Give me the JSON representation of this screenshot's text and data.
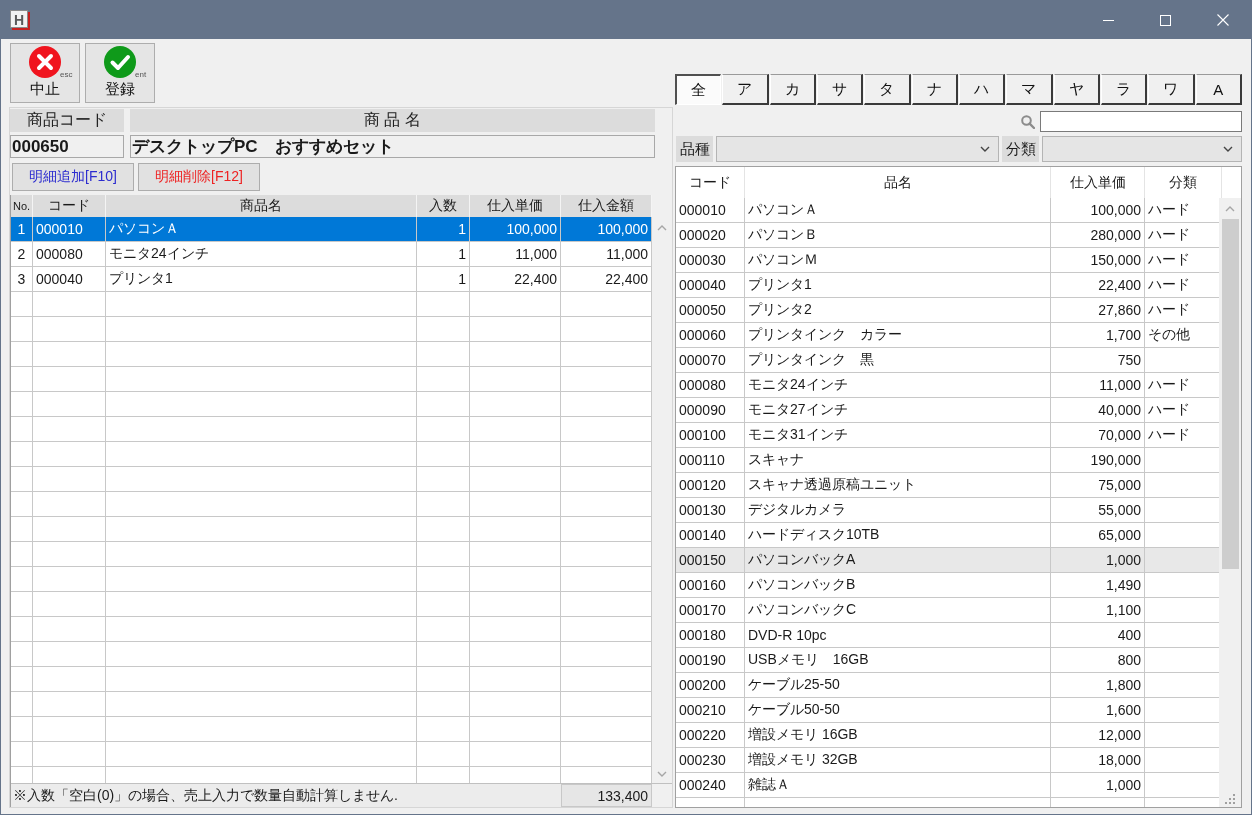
{
  "window": {
    "logo": "H"
  },
  "toolbar": [
    {
      "kind": "cancel",
      "label": "中止",
      "key": "esc"
    },
    {
      "kind": "save",
      "label": "登録",
      "key": "ent"
    }
  ],
  "product": {
    "code_label": "商品コード",
    "name_label": "商 品 名",
    "code": "000650",
    "name": "デスクトップPC　おすすめセット"
  },
  "detail_buttons": [
    {
      "kind": "add",
      "label": "明細追加[F10]"
    },
    {
      "kind": "delete",
      "label": "明細削除[F12]"
    }
  ],
  "detail_table": {
    "columns": [
      "No.",
      "コード",
      "商品名",
      "入数",
      "仕入単価",
      "仕入金額"
    ],
    "rows": [
      {
        "no": "1",
        "code": "000010",
        "name": "パソコンＡ",
        "qty": "1",
        "unit_price": "100,000",
        "amount": "100,000",
        "selected": true
      },
      {
        "no": "2",
        "code": "000080",
        "name": "モニタ24インチ",
        "qty": "1",
        "unit_price": "11,000",
        "amount": "11,000",
        "selected": false
      },
      {
        "no": "3",
        "code": "000040",
        "name": "プリンタ1",
        "qty": "1",
        "unit_price": "22,400",
        "amount": "22,400",
        "selected": false
      }
    ],
    "note": "※入数「空白(0)」の場合、売上入力で数量自動計算しません.",
    "total": "133,400"
  },
  "kana_tabs": [
    {
      "label": "全",
      "selected": true
    },
    {
      "label": "ア",
      "selected": false
    },
    {
      "label": "カ",
      "selected": false
    },
    {
      "label": "サ",
      "selected": false
    },
    {
      "label": "タ",
      "selected": false
    },
    {
      "label": "ナ",
      "selected": false
    },
    {
      "label": "ハ",
      "selected": false
    },
    {
      "label": "マ",
      "selected": false
    },
    {
      "label": "ヤ",
      "selected": false
    },
    {
      "label": "ラ",
      "selected": false
    },
    {
      "label": "ワ",
      "selected": false
    },
    {
      "label": "A",
      "selected": false
    }
  ],
  "filters": [
    {
      "label": "品種"
    },
    {
      "label": "分類"
    }
  ],
  "product_table": {
    "columns": [
      "コード",
      "品名",
      "仕入単価",
      "分類"
    ],
    "rows": [
      {
        "code": "000010",
        "name": "パソコンＡ",
        "unit_price": "100,000",
        "category": "ハード",
        "selected": false
      },
      {
        "code": "000020",
        "name": "パソコンＢ",
        "unit_price": "280,000",
        "category": "ハード",
        "selected": false
      },
      {
        "code": "000030",
        "name": "パソコンＭ",
        "unit_price": "150,000",
        "category": "ハード",
        "selected": false
      },
      {
        "code": "000040",
        "name": "プリンタ1",
        "unit_price": "22,400",
        "category": "ハード",
        "selected": false
      },
      {
        "code": "000050",
        "name": "プリンタ2",
        "unit_price": "27,860",
        "category": "ハード",
        "selected": false
      },
      {
        "code": "000060",
        "name": "プリンタインク　カラー",
        "unit_price": "1,700",
        "category": "その他",
        "selected": false
      },
      {
        "code": "000070",
        "name": "プリンタインク　黒",
        "unit_price": "750",
        "selected": false
      },
      {
        "code": "000080",
        "name": "モニタ24インチ",
        "unit_price": "11,000",
        "category": "ハード",
        "selected": false
      },
      {
        "code": "000090",
        "name": "モニタ27インチ",
        "unit_price": "40,000",
        "category": "ハード",
        "selected": false
      },
      {
        "code": "000100",
        "name": "モニタ31インチ",
        "unit_price": "70,000",
        "category": "ハード",
        "selected": false
      },
      {
        "code": "000110",
        "name": "スキャナ",
        "unit_price": "190,000",
        "selected": false
      },
      {
        "code": "000120",
        "name": "スキャナ透過原稿ユニット",
        "unit_price": "75,000",
        "selected": false
      },
      {
        "code": "000130",
        "name": "デジタルカメラ",
        "unit_price": "55,000",
        "selected": false
      },
      {
        "code": "000140",
        "name": "ハードディスク10TB",
        "unit_price": "65,000",
        "selected": false
      },
      {
        "code": "000150",
        "name": "パソコンバックA",
        "unit_price": "1,000",
        "selected": true
      },
      {
        "code": "000160",
        "name": "パソコンバックB",
        "unit_price": "1,490",
        "selected": false
      },
      {
        "code": "000170",
        "name": "パソコンバックC",
        "unit_price": "1,100",
        "selected": false
      },
      {
        "code": "000180",
        "name": "DVD-R 10pc",
        "unit_price": "400",
        "selected": false
      },
      {
        "code": "000190",
        "name": "USBメモリ　16GB",
        "unit_price": "800",
        "selected": false
      },
      {
        "code": "000200",
        "name": "ケーブル25-50",
        "unit_price": "1,800",
        "selected": false
      },
      {
        "code": "000210",
        "name": "ケーブル50-50",
        "unit_price": "1,600",
        "selected": false
      },
      {
        "code": "000220",
        "name": "増設メモリ 16GB",
        "unit_price": "12,000",
        "selected": false
      },
      {
        "code": "000230",
        "name": "増設メモリ 32GB",
        "unit_price": "18,000",
        "selected": false
      },
      {
        "code": "000240",
        "name": "雑誌Ａ",
        "unit_price": "1,000",
        "selected": false
      }
    ]
  }
}
